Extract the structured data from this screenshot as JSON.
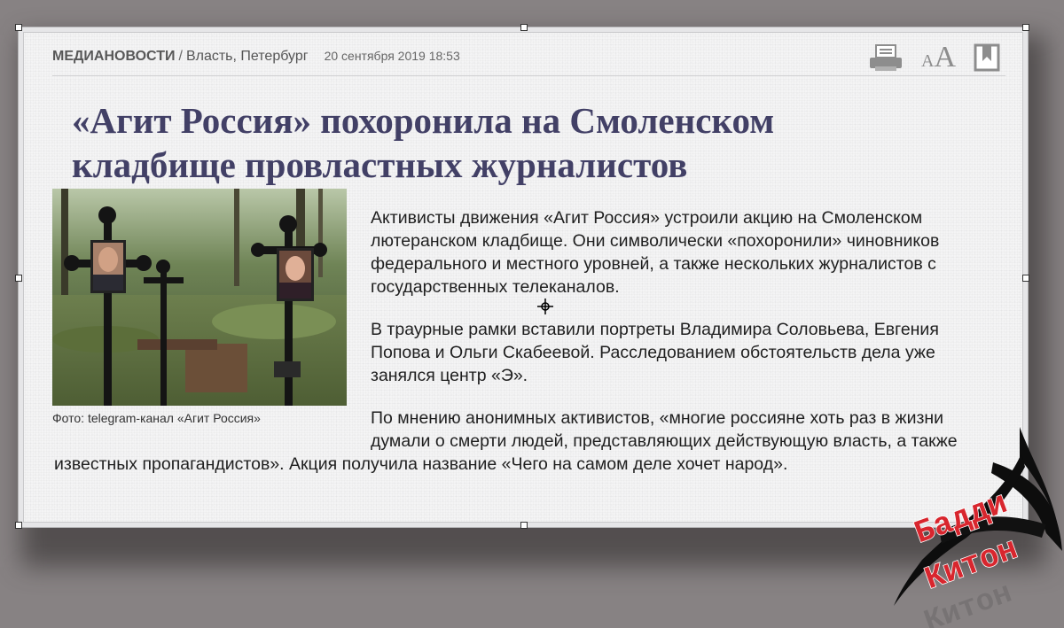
{
  "header": {
    "brand": "МЕДИАНОВОСТИ",
    "separator": "/",
    "section": "Власть, Петербург",
    "date": "20 сентября 2019 18:53"
  },
  "toolbar": {
    "print_icon": "printer-icon",
    "font_small": "A",
    "font_big": "A",
    "bookmark_icon": "bookmark-icon"
  },
  "article": {
    "title": "«Агит Россия» похоронила на Смоленском кладбище провластных журналистов",
    "photo_caption": "Фото: telegram-канал «Агит Россия»",
    "paragraphs": [
      "Активисты движения «Агит Россия» устроили акцию на Смоленском лютеранском кладбище. Они символически «похоронили»  чиновников федерального и местного уровней, а также нескольких журналистов с государственных телеканалов.",
      "В траурные рамки вставили портреты Владимира Соловьева, Евгения Попова и Ольги Скабеевой. Расследованием обстоятельств дела уже занялся центр «Э».",
      "По мнению анонимных активистов, «многие россияне хоть раз в жизни думали о смерти людей, представляющих действующую власть, а также известных пропагандистов». Акция получила название «Чего на самом деле хочет народ»."
    ]
  },
  "watermark": {
    "line1": "Бадди",
    "line2": "Китон"
  },
  "colors": {
    "background": "#878283",
    "headline": "#424066",
    "watermark_red": "#d8262e"
  }
}
